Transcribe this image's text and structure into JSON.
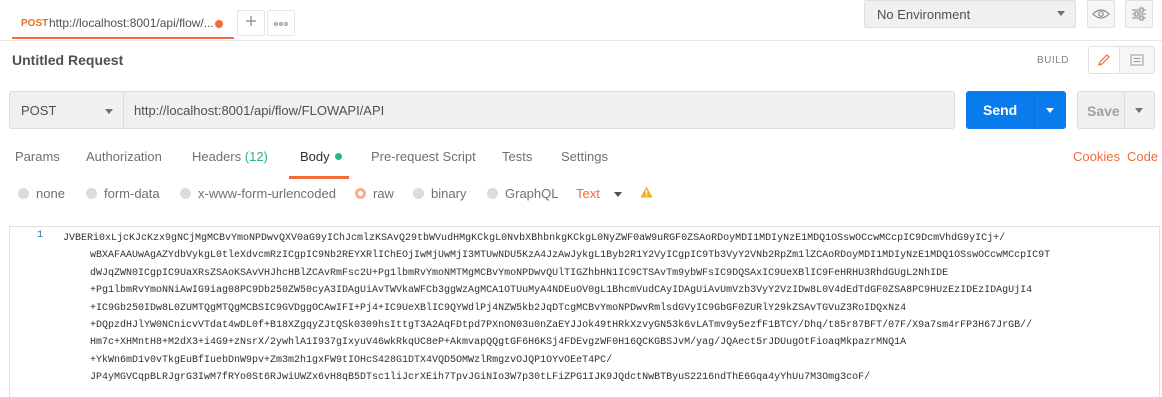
{
  "top_tab": {
    "method": "POST",
    "url": "http://localhost:8001/api/flow/..."
  },
  "environment": {
    "selected": "No Environment"
  },
  "request": {
    "title": "Untitled Request",
    "build_label": "BUILD",
    "method": "POST",
    "url": "http://localhost:8001/api/flow/FLOWAPI/API",
    "send_label": "Send",
    "save_label": "Save"
  },
  "tabs": {
    "params": "Params",
    "authorization": "Authorization",
    "headers": "Headers",
    "headers_count": "(12)",
    "body": "Body",
    "prerequest": "Pre-request Script",
    "tests": "Tests",
    "settings": "Settings",
    "cookies": "Cookies",
    "code": "Code"
  },
  "body_types": {
    "none": "none",
    "form_data": "form-data",
    "urlencoded": "x-www-form-urlencoded",
    "raw": "raw",
    "binary": "binary",
    "graphql": "GraphQL",
    "format": "Text",
    "selected": "raw"
  },
  "editor": {
    "line_number": "1",
    "lines": [
      "JVBERi0xLjcKJcKzx9gNCjMgMCBvYmoNPDwvQXV0aG9yIChJcmlzKSAvQ29tbWVudHMgKCkgL0NvbXBhbnkgKCkgL0NyZWF0aW9uRGF0ZSAoRDoyMDI1MDIyNzE1MDQ1OSswOCcwMCcpIC9DcmVhdG9yICj+/",
      "wBXAFAAUwAgAZYdbVykgL0tleXdvcmRzICgpIC9Nb2REYXRlIChEOjIwMjUwMjI3MTUwNDU5KzA4JzAwJykgL1Byb2R1Y2VyICgpIC9Tb3VyY2VNb2RpZm1lZCAoRDoyMDI1MDIyNzE1MDQ1OSswOCcwMCcpIC9T",
      "dWJqZWN0ICgpIC9UaXRsZSAoKSAvVHJhcHBlZCAvRmFsc2U+Pg1lbmRvYmoNMTMgMCBvYmoNPDwvQUlTIGZhbHN1IC9CTSAvTm9ybWFsIC9DQSAxIC9UeXBlIC9FeHRHU3RhdGUgL2NhIDE",
      "+Pg1lbmRvYmoNNiAwIG9iag08PC9Db250ZW50cyA3IDAgUiAvTWVkaWFCb3ggWzAgMCA1OTUuMyA4NDEuOV0gL1BhcmVudCAyIDAgUiAvUmVzb3VyY2VzIDw8L0V4dEdTdGF0ZSA8PC9HUzEzIDEzIDAgUjI4",
      "+IC9Gb250IDw8L0ZUMTQgMTQgMCBSIC9GVDggOCAwIFI+Pj4+IC9UeXBlIC9QYWdlPj4NZW5kb2JqDTcgMCBvYmoNPDwvRmlsdGVyIC9GbGF0ZURlY29kZSAvTGVuZ3RoIDQxNz4",
      "+DQpzdHJlYW0NCnicvVTdat4wDL0f+B18XZgqyZJtQSk0309hsIttgT3A2AqFDtpd7PXnON03u0nZaEYJJok49tHRkXzvyGN53k6vLATmv9y5ezfF1BTCY/Dhq/t85r87BFT/07F/X9a7sm4rFP3H67JrGB//",
      "Hm7c+XHMntH8+M2dX3+i4G9+zNsrX/2ywhlA1I937gIxyuV46wkRkqUC8eP+AkmvapQQgtGF6H6KSj4FDEvgzWF0H16QCKGBSJvM/yag/JQAect5rJDUugOtFioaqMkpazrMNQ1A",
      "+YkWn6mD1v0vTkgEuBfIuebDnW9pv+Zm3m2h1gxFW9tIOHcS428G1DTX4VQD5OMWzlRmgzvOJQP1OYvOEeT4PC/",
      "JP4yMGVCqpBLRJgrG3IwM7fRYo0St6RJwiUWZx6vH8qB5DTsc1liJcrXEih7TpvJGiNIo3W7p30tLFiZPG1IJK9JQdctNwBTByuS2216ndThE6Gqa4yYhUu7M3Omg3coF/"
    ]
  }
}
